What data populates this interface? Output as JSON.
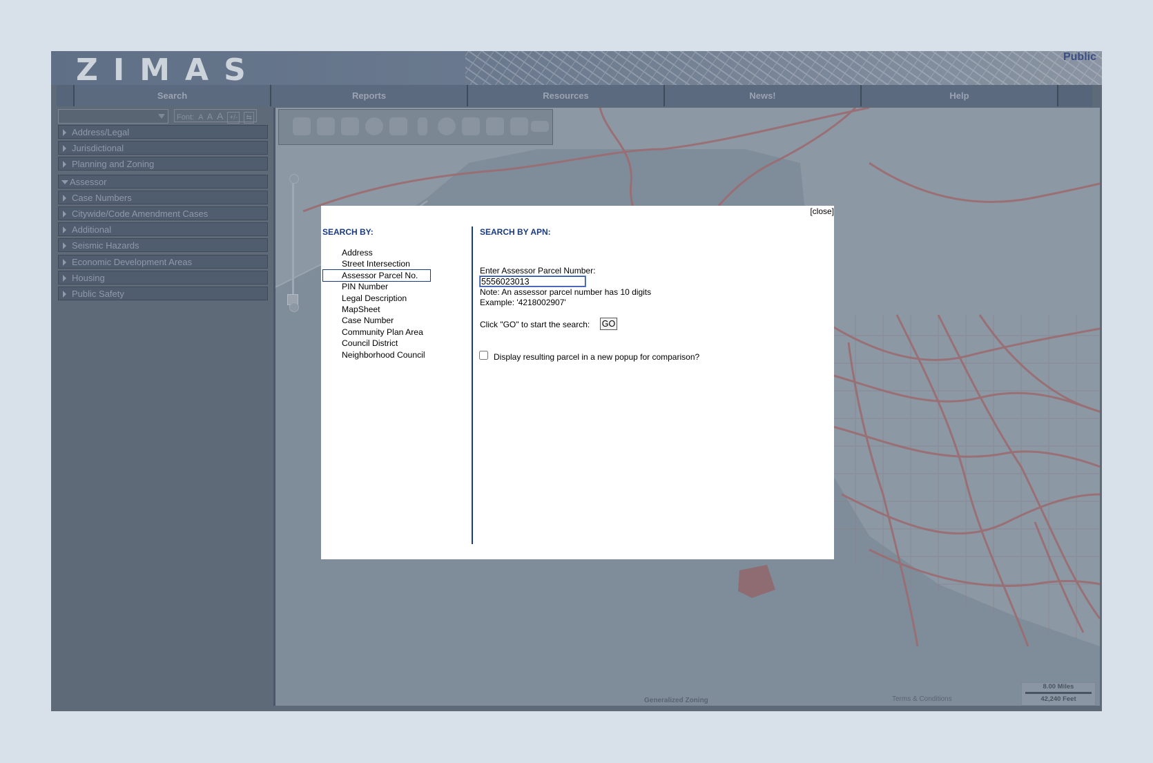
{
  "app": {
    "logo": "ZIMAS",
    "mode_label": "Public"
  },
  "nav": {
    "tabs": [
      "Search",
      "Reports",
      "Resources",
      "News!",
      "Help"
    ]
  },
  "sidebar": {
    "font_label": "Font:",
    "font_sizes": [
      "A",
      "A",
      "A"
    ],
    "font_toggle": "+/-",
    "accordion": [
      {
        "label": "Address/Legal",
        "open": false
      },
      {
        "label": "Jurisdictional",
        "open": false
      },
      {
        "label": "Planning and Zoning",
        "open": false
      },
      {
        "label": "Assessor",
        "open": true
      },
      {
        "label": "Case Numbers",
        "open": false
      },
      {
        "label": "Citywide/Code Amendment Cases",
        "open": false
      },
      {
        "label": "Additional",
        "open": false
      },
      {
        "label": "Seismic Hazards",
        "open": false
      },
      {
        "label": "Economic Development Areas",
        "open": false
      },
      {
        "label": "Housing",
        "open": false
      },
      {
        "label": "Public Safety",
        "open": false
      }
    ]
  },
  "map": {
    "layer_label": "Generalized Zoning",
    "terms_label": "Terms & Conditions",
    "scale_miles": "8.00 Miles",
    "scale_feet": "42,240 Feet",
    "tool_icons": [
      "pan-icon",
      "zoom-in-icon",
      "zoom-extent-icon",
      "identify-icon",
      "select-icon",
      "measure-icon",
      "comment-icon",
      "legend-icon",
      "layers-icon",
      "print-icon",
      "export-icon"
    ]
  },
  "modal": {
    "close_label": "[close]",
    "search_by_heading": "SEARCH BY:",
    "search_by_options": [
      "Address",
      "Street Intersection",
      "Assessor Parcel No.",
      "PIN Number",
      "Legal Description",
      "MapSheet",
      "Case Number",
      "Community Plan Area",
      "Council District",
      "Neighborhood Council"
    ],
    "selected_option": "Assessor Parcel No.",
    "apn_heading": "SEARCH BY APN:",
    "apn_label": "Enter Assessor Parcel Number:",
    "apn_value": "5556023013",
    "apn_note": "Note: An assessor parcel number has 10 digits",
    "apn_example": "Example: '4218002907'",
    "go_prompt": "Click \"GO\" to start the search:",
    "go_label": "GO",
    "popup_checkbox_label": "Display resulting parcel in a new popup for comparison?",
    "popup_checked": false
  }
}
